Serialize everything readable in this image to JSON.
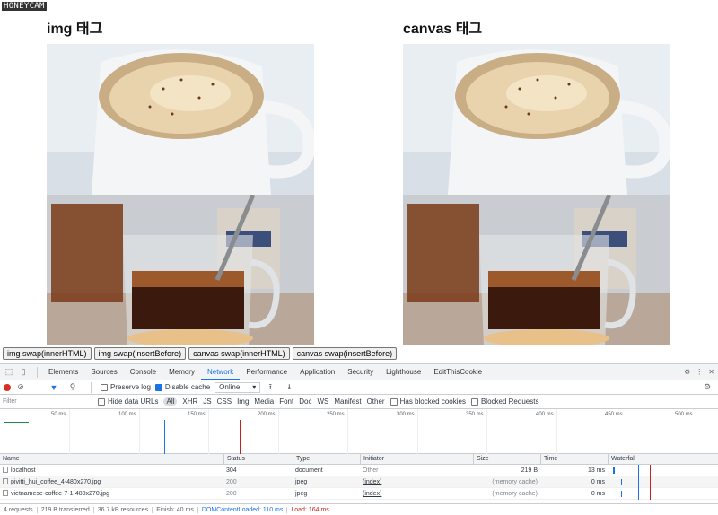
{
  "watermark": "HONEYCAM",
  "left": {
    "title": "img 태그"
  },
  "right": {
    "title": "canvas 태그"
  },
  "buttons": [
    "img swap(innerHTML)",
    "img swap(insertBefore)",
    "canvas swap(innerHTML)",
    "canvas swap(insertBefore)"
  ],
  "devtools": {
    "tabs": [
      "Elements",
      "Sources",
      "Console",
      "Memory",
      "Network",
      "Performance",
      "Application",
      "Security",
      "Lighthouse",
      "EditThisCookie"
    ],
    "active_tab": "Network",
    "toolbar": {
      "preserve_log": "Preserve log",
      "disable_cache": "Disable cache",
      "disable_cache_checked": true,
      "throttling": "Online"
    },
    "filter": {
      "placeholder": "Filter",
      "hide_data_urls": "Hide data URLs",
      "types": [
        "All",
        "XHR",
        "JS",
        "CSS",
        "Img",
        "Media",
        "Font",
        "Doc",
        "WS",
        "Manifest",
        "Other"
      ],
      "has_blocked_cookies": "Has blocked cookies",
      "blocked_requests": "Blocked Requests"
    },
    "timeline_ticks": [
      "50 ms",
      "100 ms",
      "150 ms",
      "200 ms",
      "250 ms",
      "300 ms",
      "350 ms",
      "400 ms",
      "450 ms",
      "500 ms"
    ],
    "columns": [
      "Name",
      "Status",
      "Type",
      "Initiator",
      "Size",
      "Time",
      "Waterfall"
    ],
    "rows": [
      {
        "name": "localhost",
        "status": "304",
        "type": "document",
        "initiator": "Other",
        "size": "219 B",
        "time": "13 ms"
      },
      {
        "name": "pivitti_hui_coffee_4-480x270.jpg",
        "status": "200",
        "type": "jpeg",
        "initiator": "(index)",
        "size": "(memory cache)",
        "time": "0 ms"
      },
      {
        "name": "vietnamese-coffee-7-1-480x270.jpg",
        "status": "200",
        "type": "jpeg",
        "initiator": "(index)",
        "size": "(memory cache)",
        "time": "0 ms"
      }
    ],
    "status": {
      "requests": "4 requests",
      "transferred": "219 B transferred",
      "resources": "36.7 kB resources",
      "finish": "Finish: 40 ms",
      "dcl": "DOMContentLoaded: 110 ms",
      "load": "Load: 164 ms"
    },
    "colors": {
      "accent": "#1a73e8",
      "record": "#d93025",
      "load": "#c5221f"
    }
  }
}
